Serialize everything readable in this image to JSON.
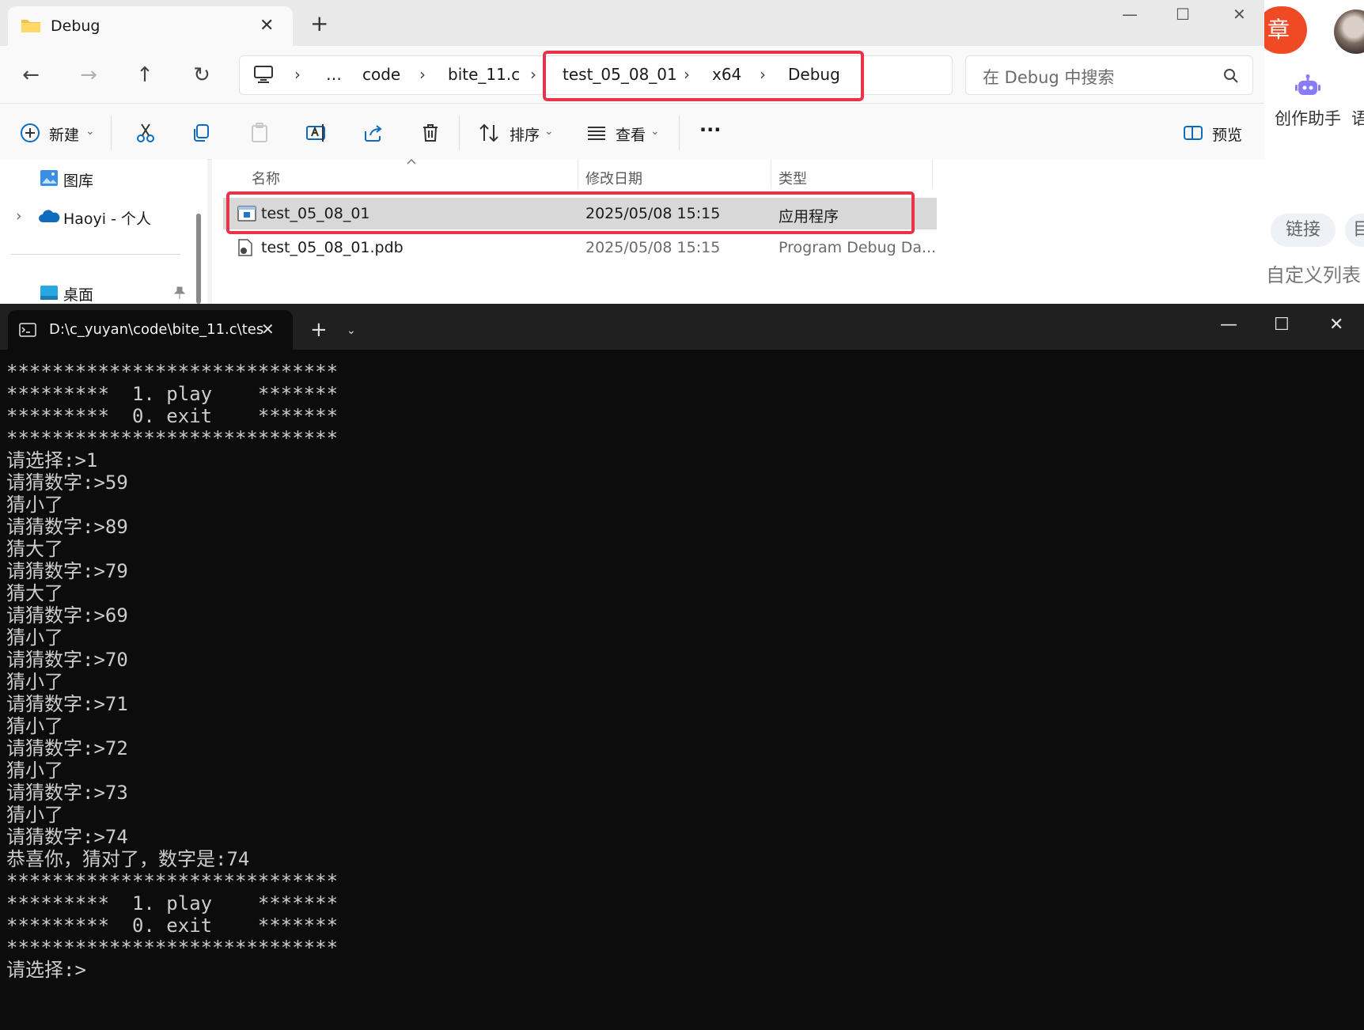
{
  "explorer": {
    "tab_title": "Debug",
    "close_glyph": "✕",
    "new_tab_glyph": "+",
    "window_controls": {
      "minimize": "—",
      "maximize": "☐",
      "close": "✕"
    },
    "nav": {
      "back": "←",
      "forward": "→",
      "up": "↑",
      "refresh": "↻"
    },
    "breadcrumbs": [
      "…",
      "code",
      "bite_11.c",
      "test_05_08_01",
      "x64",
      "Debug"
    ],
    "crumb_separator": "›",
    "search_placeholder": "在 Debug 中搜索",
    "toolbar": {
      "new_label": "新建",
      "sort_label": "排序",
      "view_label": "查看",
      "more_label": "···",
      "preview_label": "预览",
      "caret": "⌄"
    },
    "nav_pane": {
      "gallery": "图库",
      "onedrive": "Haoyi - 个人",
      "desktop": "桌面",
      "expand_glyph": "›"
    },
    "columns": {
      "name": "名称",
      "modified": "修改日期",
      "type": "类型"
    },
    "files": [
      {
        "name": "test_05_08_01",
        "modified": "2025/05/08 15:15",
        "type": "应用程序",
        "selected": true
      },
      {
        "name": "test_05_08_01.pdb",
        "modified": "2025/05/08 15:15",
        "type": "Program Debug Da...",
        "selected": false
      }
    ]
  },
  "browser_strip": {
    "orange_button_char": "章",
    "assistant_label": "创作助手",
    "language_char": "语",
    "link_chip": "链接",
    "second_chip_char": "目",
    "custom_list": "自定义列表"
  },
  "terminal": {
    "tab_title": "D:\\c_yuyan\\code\\bite_11.c\\tes",
    "close_glyph": "✕",
    "new_tab_glyph": "+",
    "dropdown_glyph": "⌄",
    "window_controls": {
      "minimize": "—",
      "maximize": "☐",
      "close": "✕"
    },
    "lines": [
      "*****************************",
      "*********  1. play    *******",
      "*********  0. exit    *******",
      "*****************************",
      "请选择:>1",
      "请猜数字:>59",
      "猜小了",
      "请猜数字:>89",
      "猜大了",
      "请猜数字:>79",
      "猜大了",
      "请猜数字:>69",
      "猜小了",
      "请猜数字:>70",
      "猜小了",
      "请猜数字:>71",
      "猜小了",
      "请猜数字:>72",
      "猜小了",
      "请猜数字:>73",
      "猜小了",
      "请猜数字:>74",
      "恭喜你，猜对了，数字是:74",
      "*****************************",
      "*********  1. play    *******",
      "*********  0. exit    *******",
      "*****************************",
      "请选择:>"
    ]
  },
  "colors": {
    "highlight_red": "#e8334a",
    "accent_orange": "#f04a24",
    "terminal_bg": "#0c0c0c",
    "terminal_text": "#cccccc"
  }
}
